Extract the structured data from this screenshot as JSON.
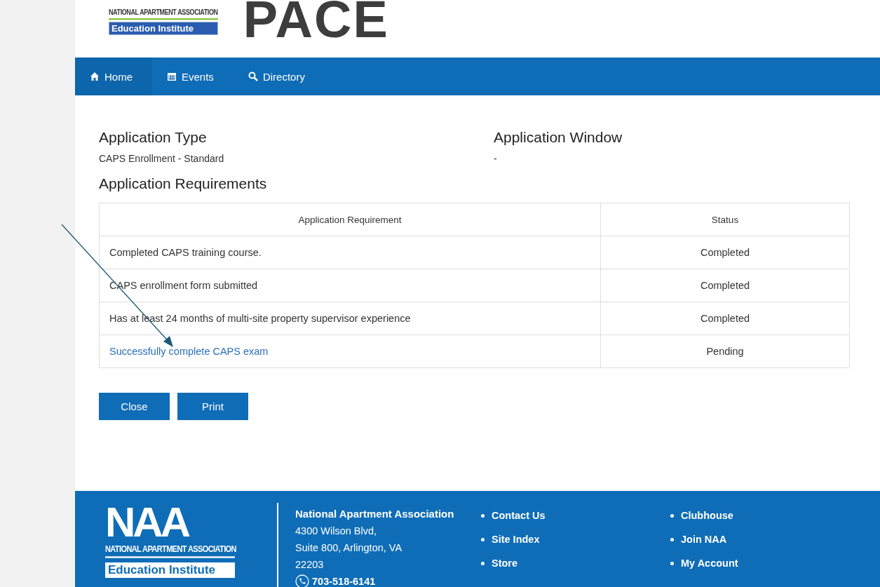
{
  "header": {
    "logo_tagline": "NATIONAL APARTMENT ASSOCIATION",
    "logo_badge": "Education Institute",
    "brand": "PACE"
  },
  "nav": [
    {
      "label": "Home",
      "selected": true
    },
    {
      "label": "Events",
      "selected": false
    },
    {
      "label": "Directory",
      "selected": false
    }
  ],
  "application_type": {
    "heading": "Application Type",
    "value": "CAPS Enrollment - Standard"
  },
  "application_window": {
    "heading": "Application Window",
    "value": "-"
  },
  "requirements": {
    "heading": "Application Requirements",
    "columns": [
      "Application Requirement",
      "Status"
    ],
    "rows": [
      {
        "requirement": "Completed CAPS training course.",
        "status": "Completed",
        "link": false
      },
      {
        "requirement": "CAPS enrollment form submitted",
        "status": "Completed",
        "link": false
      },
      {
        "requirement": "Has at least 24 months of multi-site property supervisor experience",
        "status": "Completed",
        "link": false
      },
      {
        "requirement": "Successfully complete CAPS exam",
        "status": "Pending",
        "link": true
      }
    ]
  },
  "buttons": [
    "Close",
    "Print"
  ],
  "footer": {
    "logo_mark": "NAA",
    "logo_tagline": "NATIONAL APARTMENT ASSOCIATION",
    "logo_badge": "Education Institute",
    "org": "National Apartment Association",
    "address": [
      "4300 Wilson Blvd,",
      "Suite 800, Arlington, VA",
      "22203"
    ],
    "phone": "703-518-6141",
    "links": [
      [
        "Contact Us",
        "Site Index",
        "Store"
      ],
      [
        "Clubhouse",
        "Join NAA",
        "My Account"
      ]
    ]
  }
}
